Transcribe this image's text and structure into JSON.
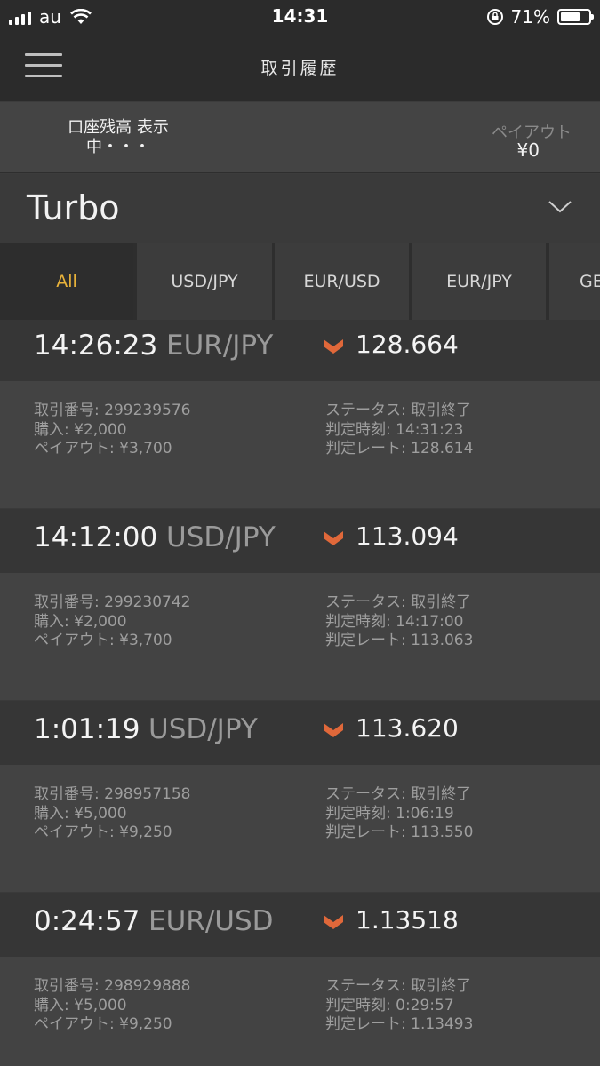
{
  "status_bar": {
    "carrier": "au",
    "time": "14:31",
    "battery_percent": "71%",
    "battery_level": 0.71
  },
  "nav": {
    "title": "取引履歴",
    "menu_icon": "hamburger-menu-icon"
  },
  "balance": {
    "label_line1": "口座残高 表示",
    "label_line2": "中・・・",
    "payout_label": "ペイアウト",
    "payout_value": "¥0"
  },
  "product": {
    "name": "Turbo",
    "dropdown_icon": "chevron-down-icon"
  },
  "tabs": [
    {
      "label": "All",
      "active": true
    },
    {
      "label": "USD/JPY",
      "active": false
    },
    {
      "label": "EUR/USD",
      "active": false
    },
    {
      "label": "EUR/JPY",
      "active": false
    },
    {
      "label": "GE",
      "active": false
    }
  ],
  "colors": {
    "accent": "#e8b23a",
    "down_arrow": "#e0683a"
  },
  "trades": [
    {
      "time": "14:26:23",
      "pair": "EUR/JPY",
      "direction": "down",
      "strike": "128.664",
      "trade_no": "取引番号: 299239576",
      "purchase": "購入: ¥2,000",
      "payout": "ペイアウト: ¥3,700",
      "status": "ステータス: 取引終了",
      "judge_time": "判定時刻: 14:31:23",
      "judge_rate": "判定レート: 128.614"
    },
    {
      "time": "14:12:00",
      "pair": "USD/JPY",
      "direction": "down",
      "strike": "113.094",
      "trade_no": "取引番号: 299230742",
      "purchase": "購入: ¥2,000",
      "payout": "ペイアウト: ¥3,700",
      "status": "ステータス: 取引終了",
      "judge_time": "判定時刻: 14:17:00",
      "judge_rate": "判定レート: 113.063"
    },
    {
      "time": "1:01:19",
      "pair": "USD/JPY",
      "direction": "down",
      "strike": "113.620",
      "trade_no": "取引番号: 298957158",
      "purchase": "購入: ¥5,000",
      "payout": "ペイアウト: ¥9,250",
      "status": "ステータス: 取引終了",
      "judge_time": "判定時刻: 1:06:19",
      "judge_rate": "判定レート: 113.550"
    },
    {
      "time": "0:24:57",
      "pair": "EUR/USD",
      "direction": "down",
      "strike": "1.13518",
      "trade_no": "取引番号: 298929888",
      "purchase": "購入: ¥5,000",
      "payout": "ペイアウト: ¥9,250",
      "status": "ステータス: 取引終了",
      "judge_time": "判定時刻: 0:29:57",
      "judge_rate": "判定レート: 1.13493"
    }
  ]
}
